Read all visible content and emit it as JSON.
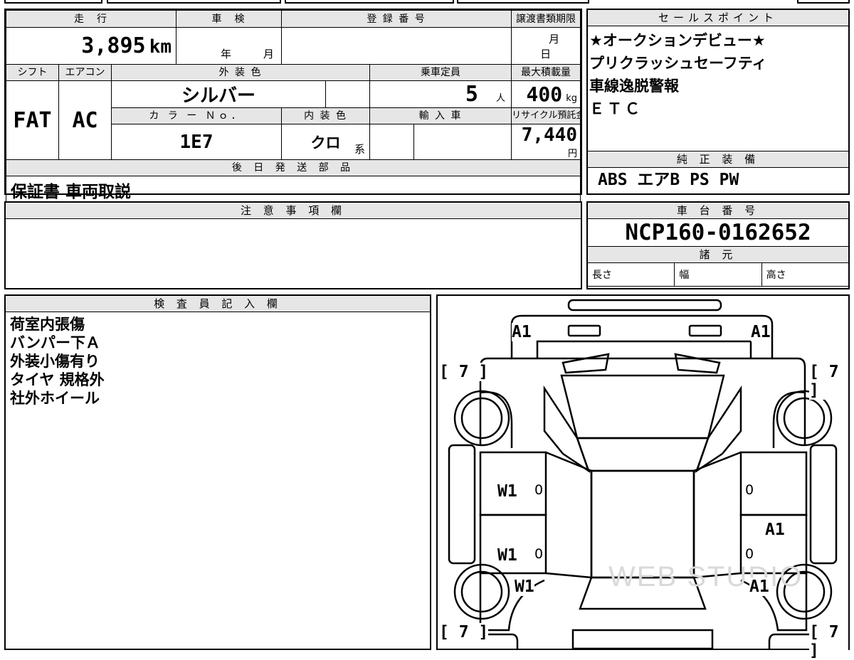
{
  "vehicle": {
    "mileage_label": "走　行",
    "mileage_value": "3,895",
    "mileage_unit": "km",
    "inspection_label": "車　検",
    "inspection_year": "年",
    "inspection_month": "月",
    "registration_label": "登 録 番 号",
    "registration_value": "",
    "transfer_label": "譲渡書類期限",
    "transfer_month": "月",
    "transfer_day": "日",
    "shift_label": "シフト",
    "shift_value": "FAT",
    "ac_label": "エアコン",
    "ac_value": "AC",
    "exterior_color_label": "外 装 色",
    "exterior_color_value": "シルバー",
    "capacity_label": "乗車定員",
    "capacity_value": "5",
    "capacity_unit": "人",
    "max_load_label": "最大積載量",
    "max_load_value": "400",
    "max_load_unit": "kg",
    "color_no_label": "カ ラ ー Ｎｏ．",
    "color_no_value": "1E7",
    "interior_color_label": "内 装 色",
    "interior_color_value": "クロ",
    "interior_color_suffix": "系",
    "import_label": "輸 入 車",
    "recycle_label": "リサイクル預託金",
    "recycle_value": "7,440",
    "recycle_unit": "円"
  },
  "later_parts": {
    "label": "後 日 発 送 部 品",
    "value": "保証書 車両取説"
  },
  "sales_points": {
    "label": "セールスポイント",
    "lines": [
      "★オークションデビュー★",
      "プリクラッシュセーフティ",
      "車線逸脱警報",
      "ＥＴＣ"
    ]
  },
  "genuine_equipment": {
    "label": "純 正 装 備",
    "value": "ABS エアB PS PW"
  },
  "notes": {
    "label": "注 意 事 項 欄",
    "value": ""
  },
  "chassis": {
    "label": "車 台 番 号",
    "value": "NCP160-0162652",
    "specs_label": "諸 元",
    "length_label": "長さ",
    "width_label": "幅",
    "height_label": "高さ"
  },
  "inspector": {
    "label": "検 査 員 記 入 欄",
    "lines": [
      "荷室内張傷",
      "バンパー下Ａ",
      "外装小傷有り",
      "タイヤ 規格外",
      "社外ホイール"
    ]
  },
  "diagram": {
    "marks": {
      "front_left": "A1",
      "front_right": "A1",
      "left_upper_bracket": "[ 7 ]",
      "right_upper_bracket": "[ 7 ]",
      "left_front_door": "W1",
      "left_front_door_num": "0",
      "right_front_door_num": "0",
      "left_rear_door": "W1",
      "left_rear_door_num": "0",
      "right_rear_door_num": "0",
      "right_rear_door": "A1",
      "left_rear_fender": "W1",
      "right_rear_fender": "A1",
      "left_lower_bracket": "[ 7 ]",
      "right_lower_bracket": "[ 7 ]"
    },
    "watermark": "WEB STUDIO"
  }
}
